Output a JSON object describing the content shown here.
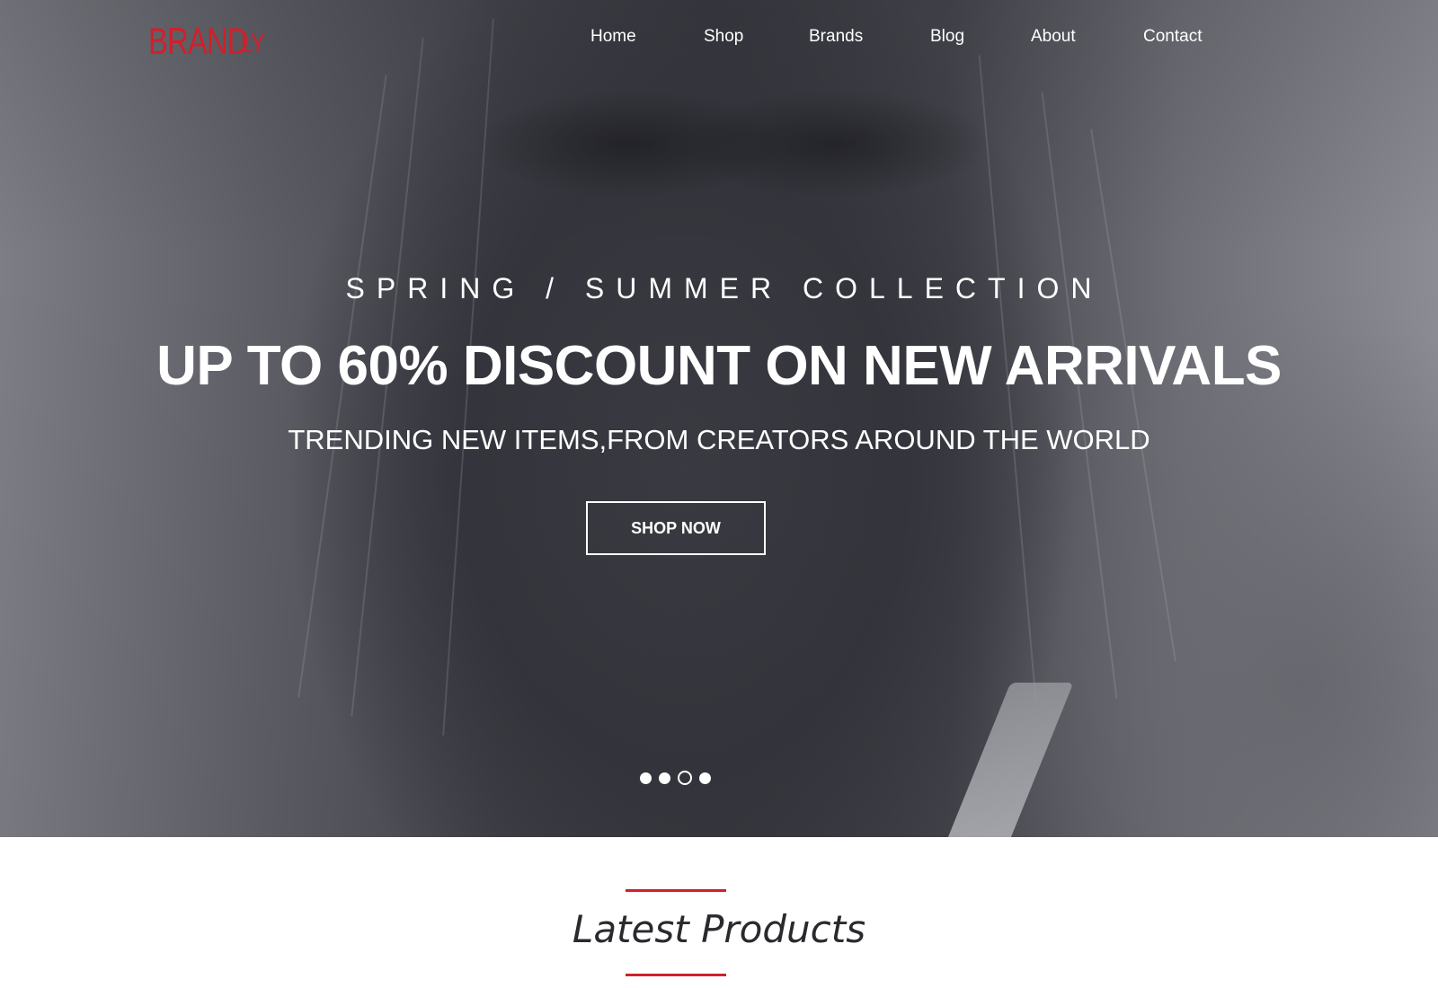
{
  "brand": {
    "name": "BRAND",
    "suffix": "LY",
    "color": "#d0202a"
  },
  "nav": {
    "items": [
      {
        "label": "Home"
      },
      {
        "label": "Shop"
      },
      {
        "label": "Brands"
      },
      {
        "label": "Blog"
      },
      {
        "label": "About"
      },
      {
        "label": "Contact"
      }
    ]
  },
  "hero": {
    "subtitle": "SPRING / SUMMER COLLECTION",
    "headline": "UP TO 60% DISCOUNT ON NEW ARRIVALS",
    "tagline": "TRENDING NEW ITEMS,FROM CREATORS AROUND THE WORLD",
    "cta_label": "SHOP NOW",
    "slider": {
      "total_slides": 4,
      "active_slide": 3
    }
  },
  "latest": {
    "title": "Latest Products",
    "accent_color": "#d0202a"
  }
}
